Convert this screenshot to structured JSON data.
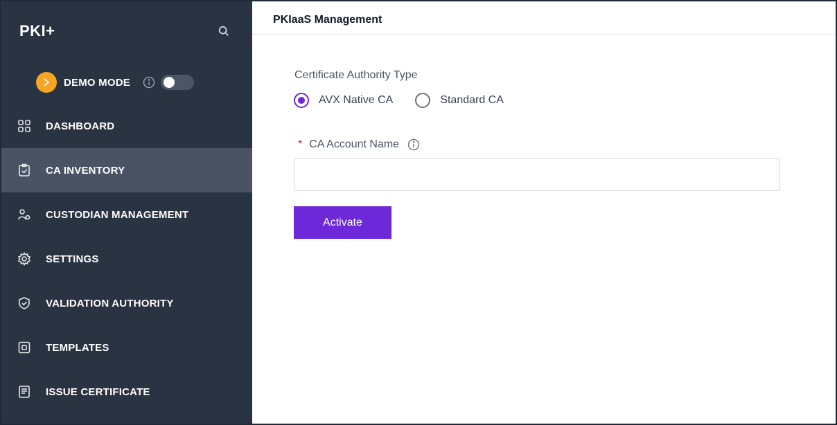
{
  "sidebar": {
    "brand": "PKI+",
    "demo_mode_label": "DEMO MODE",
    "items": [
      {
        "label": "DASHBOARD",
        "icon": "dashboard-icon"
      },
      {
        "label": "CA INVENTORY",
        "icon": "clipboard-check-icon",
        "active": true
      },
      {
        "label": "CUSTODIAN MANAGEMENT",
        "icon": "users-icon"
      },
      {
        "label": "SETTINGS",
        "icon": "gear-icon"
      },
      {
        "label": "VALIDATION AUTHORITY",
        "icon": "shield-check-icon"
      },
      {
        "label": "TEMPLATES",
        "icon": "template-icon"
      },
      {
        "label": "ISSUE CERTIFICATE",
        "icon": "certificate-icon"
      }
    ]
  },
  "header": {
    "title": "PKIaaS Management"
  },
  "form": {
    "ca_type_label": "Certificate Authority Type",
    "ca_type_options": [
      {
        "label": "AVX Native CA",
        "selected": true
      },
      {
        "label": "Standard CA",
        "selected": false
      }
    ],
    "account_required_mark": "*",
    "account_label": "CA Account Name",
    "account_value": "",
    "account_placeholder": "",
    "activate_label": "Activate"
  },
  "colors": {
    "sidebar_bg": "#2a3342",
    "sidebar_active_bg": "#4a5364",
    "accent": "#6d28d9",
    "demo_badge": "#f5a524",
    "required": "#dc2626"
  }
}
